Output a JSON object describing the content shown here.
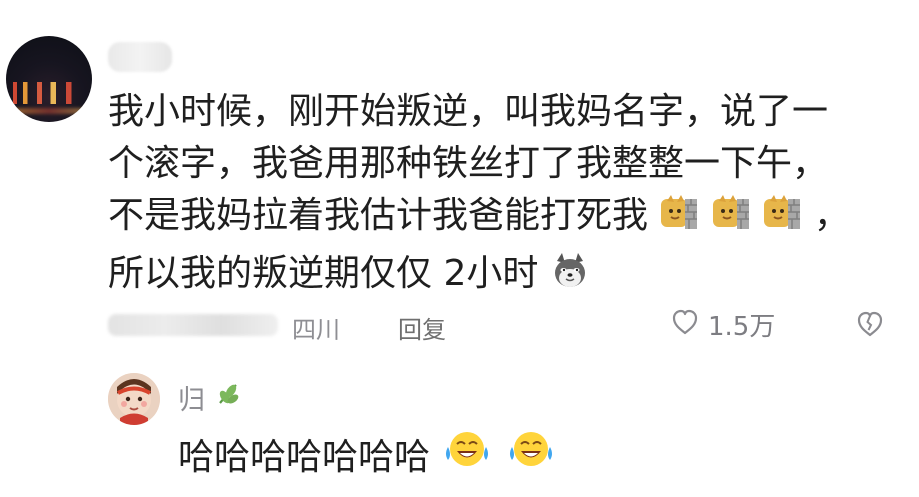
{
  "main_comment": {
    "lines": [
      "我小时候，刚开始叛逆，叫我妈名字，说了一",
      "个滚字，我爸用那种铁丝打了我整整一下午，",
      "不是我妈拉着我估计我爸能打死我",
      "所以我的叛逆期仅仅 2小时"
    ],
    "line3_suffix": "，",
    "meta": {
      "location": "四川",
      "reply_label": "回复",
      "like_count": "1.5万"
    }
  },
  "reply_comment": {
    "username": "归",
    "text": "哈哈哈哈哈哈哈"
  },
  "icons": {
    "main_avatar": "night-city-avatar",
    "wall_emoji": "cat-behind-wall-emoji",
    "dog_emoji": "husky-emoji",
    "like": "heart-outline-icon",
    "dislike": "broken-heart-icon",
    "leaf": "leaf-icon",
    "reply_avatar": "girl-avatar",
    "laugh_emoji": "tears-of-joy-emoji"
  }
}
